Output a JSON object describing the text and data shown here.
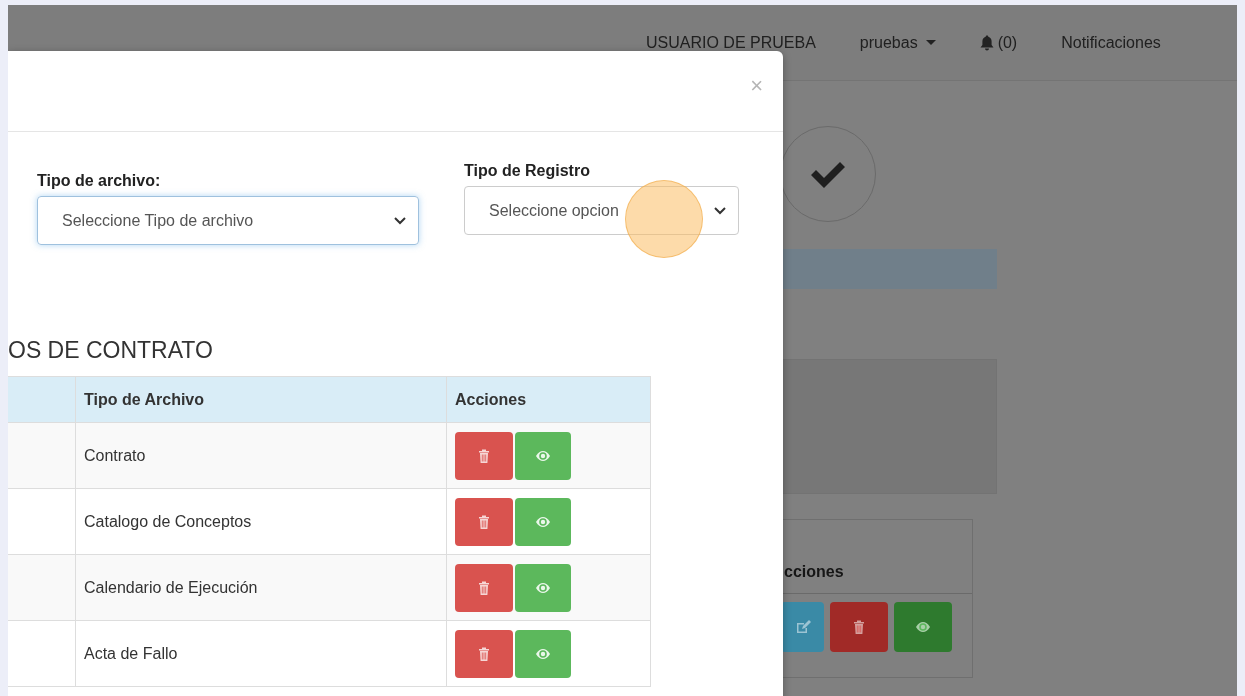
{
  "navbar": {
    "user": "USUARIO DE PRUEBA",
    "account_menu": "pruebas",
    "notifications_count": "(0)",
    "notifications_link": "Notificaciones"
  },
  "background": {
    "step_done": true,
    "table_header": "cciones",
    "row_actions": [
      {
        "kind": "edit"
      },
      {
        "kind": "delete"
      },
      {
        "kind": "view"
      }
    ]
  },
  "modal": {
    "close": "×",
    "fields": [
      {
        "label": "Tipo de archivo:",
        "placeholder": "Seleccione Tipo de archivo",
        "focused": true
      },
      {
        "label": "Tipo de Registro",
        "placeholder": "Seleccione opcion",
        "focused": false
      }
    ],
    "section_title": "OS DE CONTRATO",
    "table": {
      "columns": [
        "Tipo de Archivo",
        "Acciones"
      ],
      "rows": [
        {
          "file_type": "Contrato",
          "actions": [
            {
              "kind": "delete"
            },
            {
              "kind": "view"
            }
          ]
        },
        {
          "file_type": "Catalogo de Conceptos",
          "actions": [
            {
              "kind": "delete"
            },
            {
              "kind": "view"
            }
          ]
        },
        {
          "file_type": "Calendario de Ejecución",
          "actions": [
            {
              "kind": "delete"
            },
            {
              "kind": "view"
            }
          ]
        },
        {
          "file_type": "Acta de Fallo",
          "actions": [
            {
              "kind": "delete"
            },
            {
              "kind": "view"
            }
          ]
        }
      ]
    }
  },
  "click_marker": true
}
